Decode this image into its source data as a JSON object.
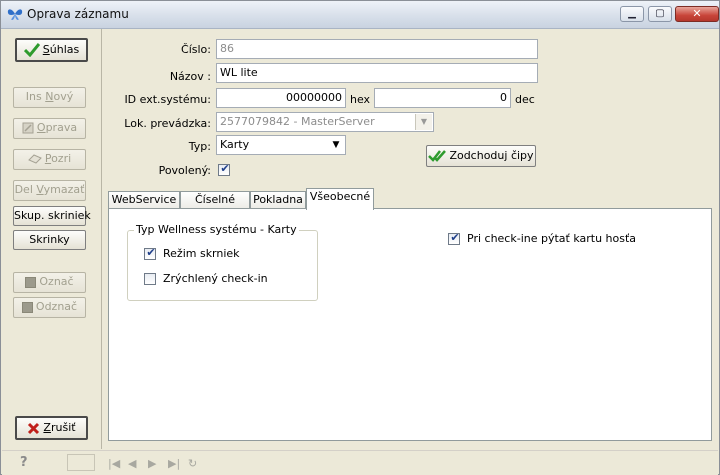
{
  "window": {
    "title": "Oprava záznamu",
    "minimize_glyph": "▁",
    "maximize_glyph": "▢",
    "close_glyph": "✕"
  },
  "left": {
    "suhlas": {
      "prefix": "",
      "underline": "S",
      "rest": "úhlas"
    },
    "ins_novy": {
      "prefix": "Ins ",
      "underline": "N",
      "rest": "ový"
    },
    "oprava": {
      "prefix": "",
      "underline": "O",
      "rest": "prava"
    },
    "pozri": {
      "prefix": "",
      "underline": "P",
      "rest": "ozri"
    },
    "del_vymazat": {
      "prefix": "Del ",
      "underline": "V",
      "rest": "ymazať"
    },
    "skup_skriniek": "Skup. skriniek",
    "skrinky": "Skrinky",
    "oznac": "Označ",
    "odznac": "Odznač",
    "zrusit": {
      "prefix": "",
      "underline": "Z",
      "rest": "rušiť"
    }
  },
  "form": {
    "cislo_label": "Číslo:",
    "cislo_value": "86",
    "nazov_label": "Názov :",
    "nazov_value": "WL lite",
    "idext_label": "ID ext.systému:",
    "idext_hex_value": "00000000",
    "hex_label": "hex",
    "idext_dec_value": "0",
    "dec_label": "dec",
    "prevadzka_label": "Lok. prevádzka:",
    "prevadzka_value": "2577079842 - MasterServer",
    "typ_label": "Typ:",
    "typ_value": "Karty",
    "povoleny_label": "Povolený:",
    "povoleny_checked": true,
    "zodchoduj_label": "Zodchoduj čipy"
  },
  "tabs": [
    {
      "label": "WebService"
    },
    {
      "label": "Číselné rady"
    },
    {
      "label": "Pokladna"
    },
    {
      "label": "Všeobecné",
      "active": true
    }
  ],
  "vseobecne": {
    "group_title": "Typ Wellness systému - Karty",
    "rezim_label": "Režim skrniek",
    "rezim_checked": true,
    "zrychleny_label": "Zrýchlený check-in",
    "zrychleny_checked": false,
    "checkin_label": "Pri check-ine pýtať kartu hosťa",
    "checkin_checked": true
  },
  "status": {
    "help_glyph": "?"
  },
  "colors": {
    "accent_check": "#2e9b2e",
    "cancel_x": "#c0201a"
  }
}
